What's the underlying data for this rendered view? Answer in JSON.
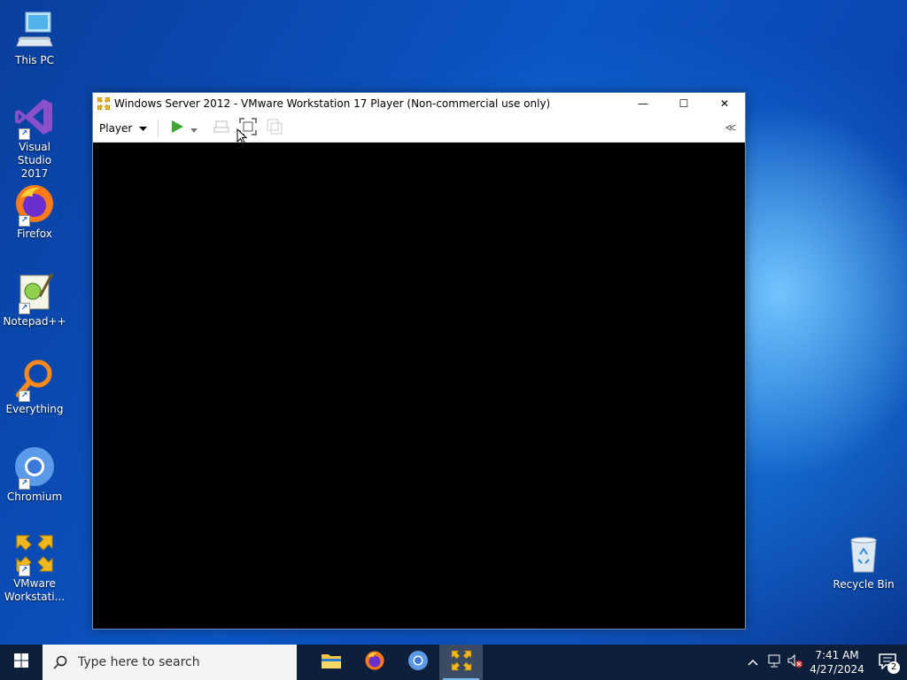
{
  "desktop": {
    "icons": [
      {
        "label": "This PC"
      },
      {
        "label": "Visual Studio 2017"
      },
      {
        "label": "Firefox"
      },
      {
        "label": "Notepad++"
      },
      {
        "label": "Everything"
      },
      {
        "label": "Chromium"
      },
      {
        "label": "VMware Workstati..."
      },
      {
        "label": "Recycle Bin"
      }
    ]
  },
  "window": {
    "title": "Windows Server 2012 - VMware Workstation 17 Player (Non-commercial use only)",
    "player_menu": "Player",
    "collapse_label": "≪",
    "minimize_symbol": "—",
    "maximize_symbol": "☐",
    "close_symbol": "✕"
  },
  "taskbar": {
    "search_placeholder": "Type here to search",
    "apps": [
      "file-explorer",
      "firefox",
      "chromium",
      "vmware"
    ],
    "time": "7:41 AM",
    "date": "4/27/2024",
    "notification_count": "2"
  },
  "colors": {
    "taskbar_bg": "#0d1f3a",
    "accent": "#76b9ed",
    "vm_screen": "#000000"
  }
}
